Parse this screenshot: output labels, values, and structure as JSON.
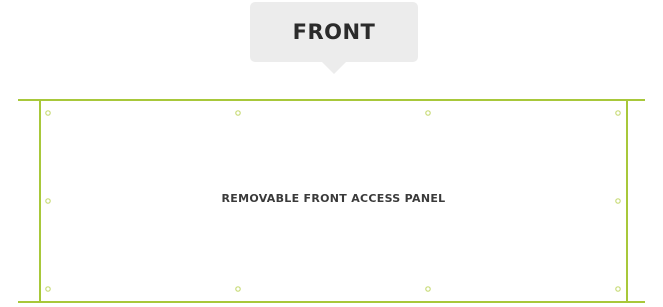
{
  "callout": {
    "label": "FRONT"
  },
  "panel": {
    "label": "REMOVABLE FRONT ACCESS PANEL",
    "stroke_color": "#a8c83a",
    "background_color": "#ffffff"
  },
  "colors": {
    "callout_bg": "#ececec",
    "callout_text": "#2b2b2b",
    "label_text": "#3a3a3a"
  }
}
